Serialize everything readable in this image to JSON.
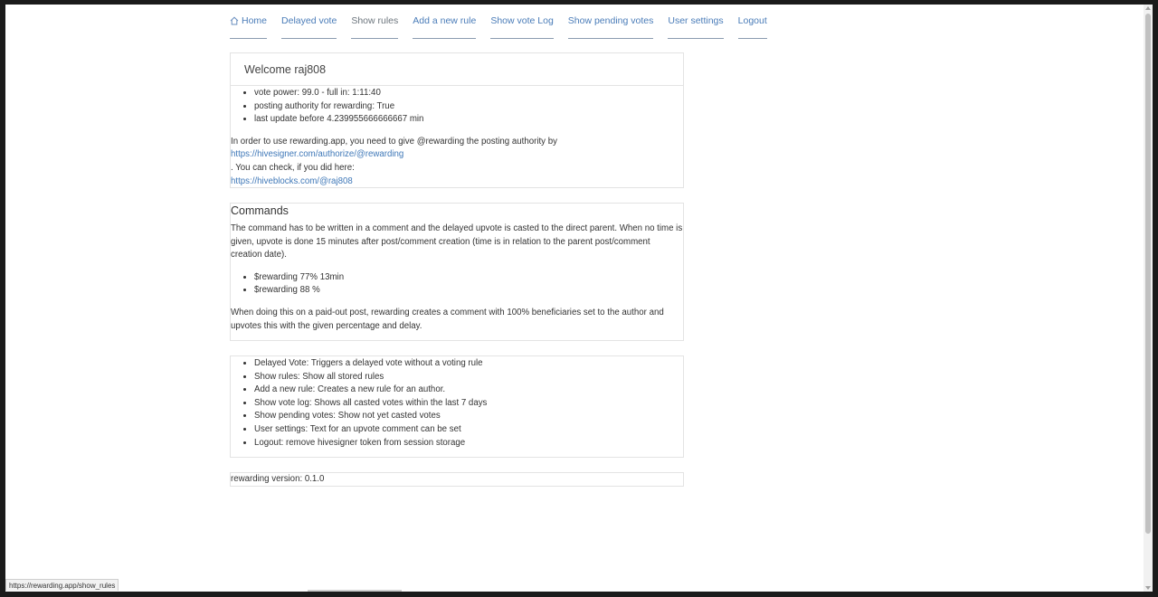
{
  "nav": {
    "home": "Home",
    "delayed_vote": "Delayed vote",
    "show_rules": "Show rules",
    "add_rule": "Add a new rule",
    "vote_log": "Show vote Log",
    "pending_votes": "Show pending votes",
    "user_settings": "User settings",
    "logout": "Logout"
  },
  "welcome": {
    "title": "Welcome raj808",
    "items": [
      "vote power: 99.0 - full in: 1:11:40",
      "posting authority for rewarding: True",
      "last update before 4.239955666666667 min"
    ],
    "text1": "In order to use rewarding.app, you need to give @rewarding the posting authority by",
    "link1": "https://hivesigner.com/authorize/@rewarding",
    "text2": ". You can check, if you did here:",
    "link2": "https://hiveblocks.com/@raj808"
  },
  "commands": {
    "title": "Commands",
    "para1": "The command has to be written in a comment and the delayed upvote is casted to the direct parent. When no time is given, upvote is done 15 minutes after post/comment creation (time is in relation to the parent post/comment creation date).",
    "items": [
      "$rewarding 77% 13min",
      "$rewarding 88 %"
    ],
    "para2": "When doing this on a paid-out post, rewarding creates a comment with 100% beneficiaries set to the author and upvotes this with the given percentage and delay."
  },
  "features": {
    "items": [
      "Delayed Vote: Triggers a delayed vote without a voting rule",
      "Show rules: Show all stored rules",
      "Add a new rule: Creates a new rule for an author.",
      "Show vote log: Shows all casted votes within the last 7 days",
      "Show pending votes: Show not yet casted votes",
      "User settings: Text for an upvote comment can be set",
      "Logout: remove hivesigner token from session storage"
    ]
  },
  "footer": {
    "version": "rewarding version: 0.1.0"
  },
  "status_url": "https://rewarding.app/show_rules",
  "colors": {
    "link": "#3f78b8",
    "nav_link": "#4a7cb8",
    "nav_active": "#6c757d"
  }
}
